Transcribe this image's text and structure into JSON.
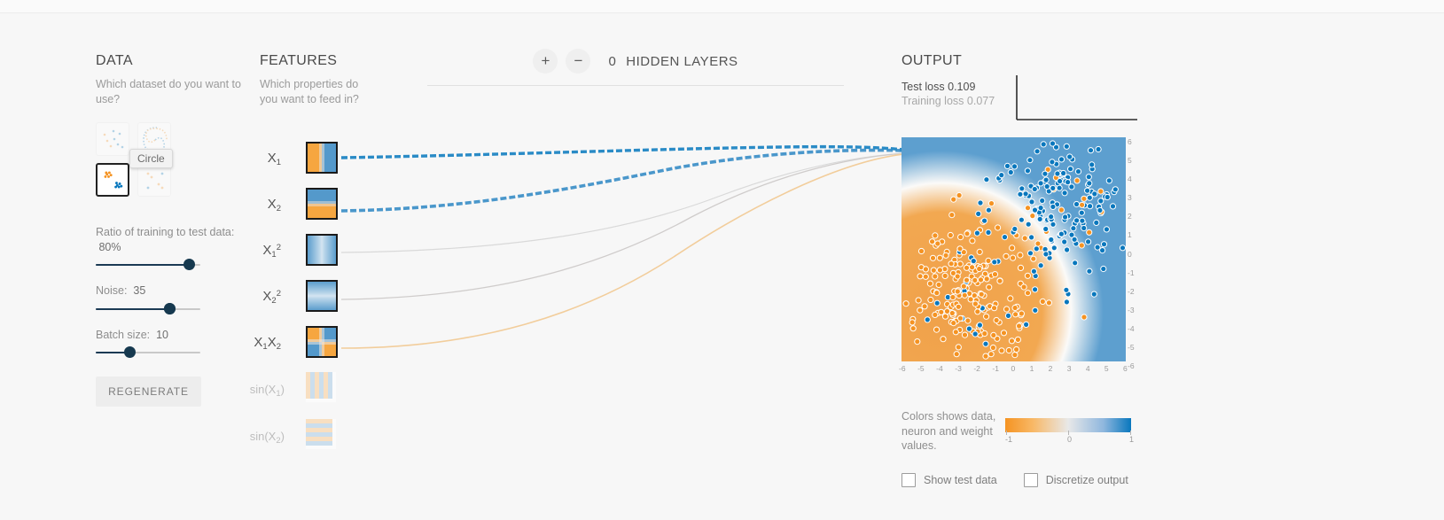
{
  "data_panel": {
    "title": "DATA",
    "subtitle": "Which dataset do you want to use?",
    "datasets": [
      {
        "name": "gauss-top-left",
        "selected": false
      },
      {
        "name": "spiral-top-right",
        "selected": false
      },
      {
        "name": "circle-bottom-left",
        "selected": true
      },
      {
        "name": "xor-bottom-right",
        "selected": false
      }
    ],
    "tooltip": "Circle",
    "ratio_label": "Ratio of training to test data:",
    "ratio_value": "80%",
    "ratio_percent": 80,
    "noise_label": "Noise:",
    "noise_value": "35",
    "noise_percent": 70,
    "batch_label": "Batch size:",
    "batch_value": "10",
    "batch_percent": 32,
    "regenerate_label": "REGENERATE"
  },
  "features_panel": {
    "title": "FEATURES",
    "subtitle": "Which properties do you want to feed in?",
    "nodes": [
      {
        "label_html": "X<sub>1</sub>",
        "pattern": "vertical-split",
        "enabled": true
      },
      {
        "label_html": "X<sub>2</sub>",
        "pattern": "horizontal-split",
        "enabled": true
      },
      {
        "label_html": "X<sub>1</sub><sup>2</sup>",
        "pattern": "vertical-band",
        "enabled": true
      },
      {
        "label_html": "X<sub>2</sub><sup>2</sup>",
        "pattern": "horizontal-band",
        "enabled": true
      },
      {
        "label_html": "X<sub>1</sub>X<sub>2</sub>",
        "pattern": "quadrant",
        "enabled": true
      },
      {
        "label_html": "sin(X<sub>1</sub>)",
        "pattern": "vertical-stripes",
        "enabled": false
      },
      {
        "label_html": "sin(X<sub>2</sub>)",
        "pattern": "horizontal-stripes",
        "enabled": false
      }
    ]
  },
  "network_panel": {
    "add_layer_label": "+",
    "remove_layer_label": "−",
    "layer_count": "0",
    "hidden_layers_label": "HIDDEN LAYERS"
  },
  "output_panel": {
    "title": "OUTPUT",
    "test_loss_label": "Test loss",
    "test_loss_value": "0.109",
    "training_loss_label": "Training loss",
    "training_loss_value": "0.077",
    "axis_ticks_x": [
      "-6",
      "-5",
      "-4",
      "-3",
      "-2",
      "-1",
      "0",
      "1",
      "2",
      "3",
      "4",
      "5",
      "6"
    ],
    "axis_ticks_y": [
      "6",
      "5",
      "4",
      "3",
      "2",
      "1",
      "0",
      "-1",
      "-2",
      "-3",
      "-4",
      "-5",
      "-6"
    ],
    "legend_text": "Colors shows data, neuron and weight values.",
    "legend_ticks": [
      "-1",
      "0",
      "1"
    ],
    "checkboxes": [
      {
        "label": "Show test data",
        "checked": false
      },
      {
        "label": "Discretize output",
        "checked": false
      }
    ]
  },
  "colors": {
    "orange": "#f59322",
    "blue": "#0877bd",
    "dark": "#16394f",
    "text": "#555555",
    "muted": "#9b9b9b"
  },
  "chart_data": {
    "type": "scatter",
    "title": "Output decision boundary (Circle dataset)",
    "xlabel": "",
    "ylabel": "",
    "xlim": [
      -6,
      6
    ],
    "ylim": [
      -6,
      6
    ],
    "grid": false,
    "legend": "Colors shows data, neuron and weight values.",
    "series": [
      {
        "name": "class-orange",
        "color": "#f59322",
        "count": 205
      },
      {
        "name": "class-blue",
        "color": "#0877bd",
        "count": 195
      }
    ],
    "background": "decision-surface: orange lower-left region, blue upper-right region, diagonal boundary"
  }
}
